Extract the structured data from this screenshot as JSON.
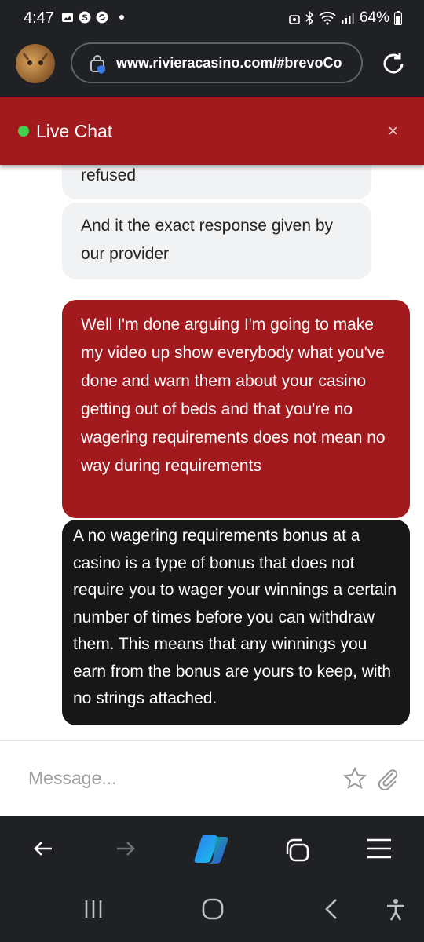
{
  "status": {
    "time": "4:47",
    "battery": "64%"
  },
  "browser": {
    "url": "www.rivieracasino.com/#brevoCo"
  },
  "chat": {
    "title": "Live Chat",
    "close_label": "×",
    "messages": [
      {
        "role": "agent",
        "text": "refused"
      },
      {
        "role": "agent",
        "text": "And it the exact response given by our provider"
      },
      {
        "role": "user",
        "text": "Well I'm done arguing I'm going to make my video up show everybody what you've done and warn them about your casino getting out of beds and that you're no wagering requirements does not mean no way during requirements"
      },
      {
        "role": "bot",
        "text": "A no wagering requirements bonus at a casino is a type of bonus that does not require you to wager your winnings a certain number of times before you can withdraw them. This means that any winnings you earn from the bonus are yours to keep, with no strings attached."
      }
    ],
    "composer_placeholder": "Message..."
  },
  "icons": {
    "status": [
      "gallery-icon",
      "s-icon",
      "sync-icon",
      "dot-icon",
      "vpn-icon",
      "bluetooth-icon",
      "wifi-icon",
      "signal-icon",
      "battery-icon"
    ],
    "browser": [
      "avatar",
      "site-info-icon",
      "reload-icon"
    ],
    "nav": [
      "back-arrow-icon",
      "forward-arrow-icon",
      "copilot-icon",
      "tabs-icon",
      "menu-icon"
    ],
    "system": [
      "recents-icon",
      "home-icon",
      "back-icon",
      "accessibility-icon"
    ]
  },
  "colors": {
    "accent": "#a31a1e",
    "bot_bubble": "#171717",
    "agent_bubble": "#f1f2f4",
    "chrome": "#202124",
    "online": "#3fd14a"
  }
}
